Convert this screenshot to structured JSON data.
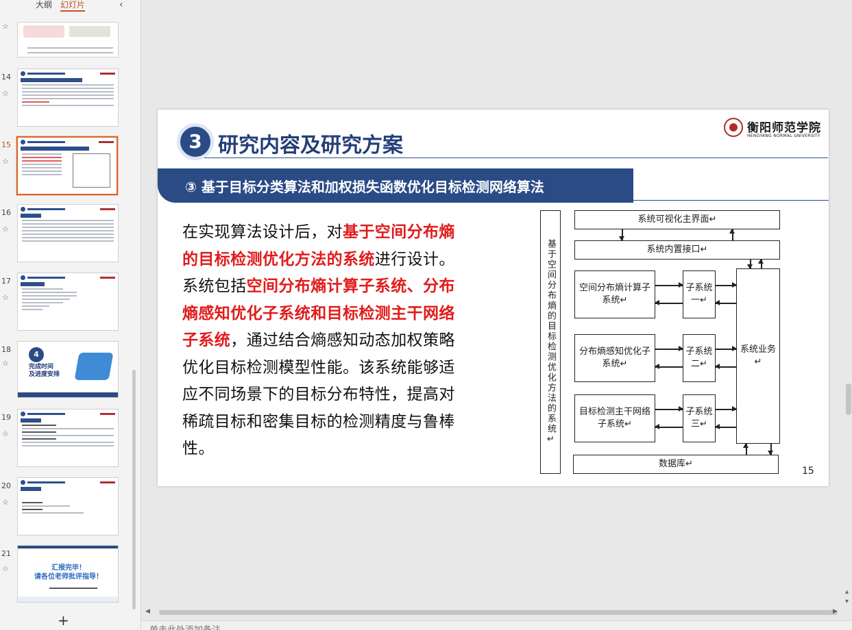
{
  "panel": {
    "tab_outline": "大纲",
    "tab_slides": "幻灯片",
    "add_slide": "+"
  },
  "thumbnails": [
    {
      "num": "",
      "top": 0
    },
    {
      "num": "14"
    },
    {
      "num": "15",
      "selected": true
    },
    {
      "num": "16"
    },
    {
      "num": "17"
    },
    {
      "num": "18"
    },
    {
      "num": "19"
    },
    {
      "num": "20"
    },
    {
      "num": "21"
    }
  ],
  "slide18_thumb": {
    "num": "4",
    "title": "完成时间\n及进度安排"
  },
  "slide21_thumb": {
    "line1": "汇报完毕！",
    "line2": "请各位老师批评指导！"
  },
  "slide": {
    "section_num": "3",
    "section_title": "研究内容及研究方案",
    "logo_cn": "衡阳师范学院",
    "logo_en": "HENGYANG NORMAL UNIVERSITY",
    "subtitle": "③  基于目标分类算法和加权损失函数优化目标检测网络算法",
    "body": {
      "p1": "在实现算法设计后，对",
      "r1": "基于空间分布熵的目标检测优化方法的系统",
      "p2": "进行设计。系统包括",
      "r2": "空间分布熵计算子系统、分布熵感知优化子系统和目标检测主干网络子系统",
      "p3": "，通过结合熵感知动态加权策略优化目标检测模型性能。该系统能够适应不同场景下的目标分布特性，提高对稀疏目标和密集目标的检测精度与鲁棒性。"
    },
    "page_number": "15",
    "diagram": {
      "side_label": "基于空间分布熵的目标检测优化方法的系统↵",
      "top_box": "系统可视化主界面↵",
      "interface_box": "系统内置接口↵",
      "sub1": "空间分布熵计算子系统↵",
      "sub2": "分布熵感知优化子系统↵",
      "sub3": "目标检测主干网络子系统↵",
      "sys1": "子系统一↵",
      "sys2": "子系统二↵",
      "sys3": "子系统三↵",
      "business": "系统业务↵",
      "database": "数据库↵"
    }
  },
  "notes": {
    "placeholder": "单击此处添加备注"
  }
}
